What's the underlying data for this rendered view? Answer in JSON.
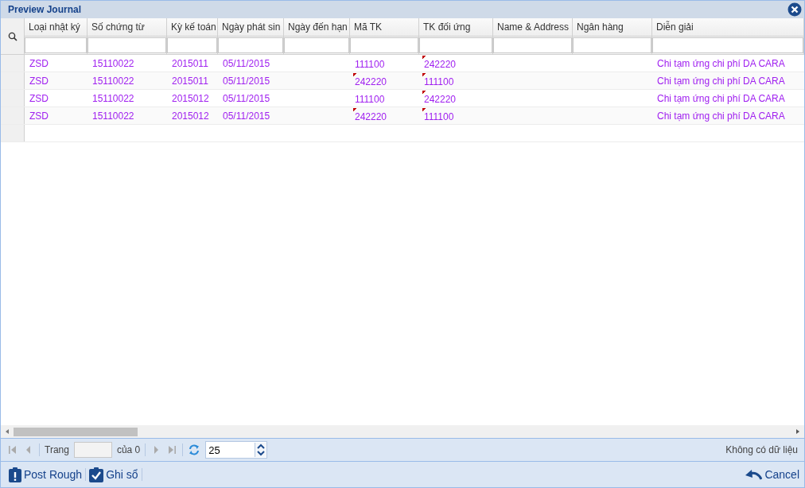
{
  "window": {
    "title": "Preview Journal"
  },
  "table": {
    "columns": [
      "Loại nhật ký",
      "Số chứng từ",
      "Kỳ kế toán",
      "Ngày phát sin",
      "Ngày đến hạn",
      "Mã TK",
      "TK đối ứng",
      "Name & Address",
      "Ngân hàng",
      "Diễn giải"
    ],
    "rows": [
      {
        "journal_type": "ZSD",
        "doc_no": "15110022",
        "period": "2015011",
        "date": "05/11/2015",
        "account": {
          "text": "111100",
          "flagged": false
        },
        "contra": {
          "text": "242220",
          "flagged": true
        },
        "description": "Chi tạm ứng chi phí DA CARA"
      },
      {
        "journal_type": "ZSD",
        "doc_no": "15110022",
        "period": "2015011",
        "date": "05/11/2015",
        "account": {
          "text": "242220",
          "flagged": true
        },
        "contra": {
          "text": "111100",
          "flagged": true
        },
        "description": "Chi tạm ứng chi phí DA CARA"
      },
      {
        "journal_type": "ZSD",
        "doc_no": "15110022",
        "period": "2015012",
        "date": "05/11/2015",
        "account": {
          "text": "111100",
          "flagged": false
        },
        "contra": {
          "text": "242220",
          "flagged": true
        },
        "description": "Chi tạm ứng chi phí DA CARA"
      },
      {
        "journal_type": "ZSD",
        "doc_no": "15110022",
        "period": "2015012",
        "date": "05/11/2015",
        "account": {
          "text": "242220",
          "flagged": true
        },
        "contra": {
          "text": "111100",
          "flagged": true
        },
        "description": "Chi tạm ứng chi phí DA CARA"
      }
    ]
  },
  "pager": {
    "nav_disabled": true,
    "page_label": "Trang",
    "of_label": "của 0",
    "page_size": "25",
    "status": "Không có dữ liệu"
  },
  "toolbar": [
    {
      "kind": "warning",
      "label": "Post Rough"
    },
    {
      "kind": "check",
      "label": "Ghi sổ"
    },
    {
      "kind": "undo",
      "label": "Cancel"
    }
  ]
}
